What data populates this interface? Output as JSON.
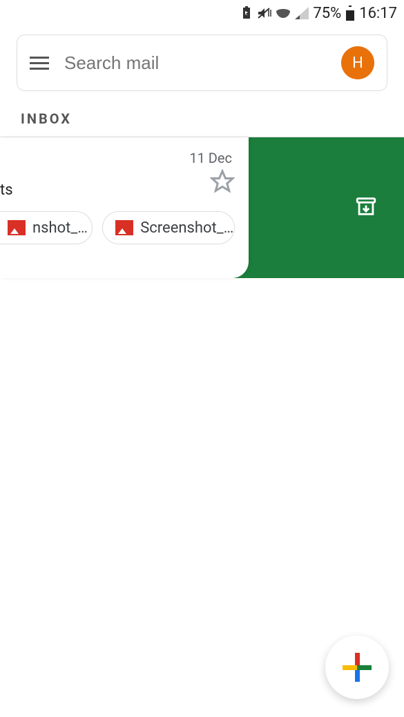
{
  "statusbar": {
    "battery_percent": "75%",
    "time": "16:17"
  },
  "search": {
    "placeholder": "Search mail"
  },
  "avatar": {
    "initial": "H",
    "color": "#e8710a"
  },
  "section": {
    "label": "INBOX"
  },
  "email": {
    "date": "11 Dec",
    "subject_partial": "ts",
    "starred": false,
    "attachments": [
      {
        "label": "nshot_…",
        "icon": "image-icon"
      },
      {
        "label": "Screenshot_…",
        "icon": "image-icon"
      }
    ]
  },
  "swipe_action": {
    "color": "#1b7e3c",
    "icon": "archive-icon"
  }
}
